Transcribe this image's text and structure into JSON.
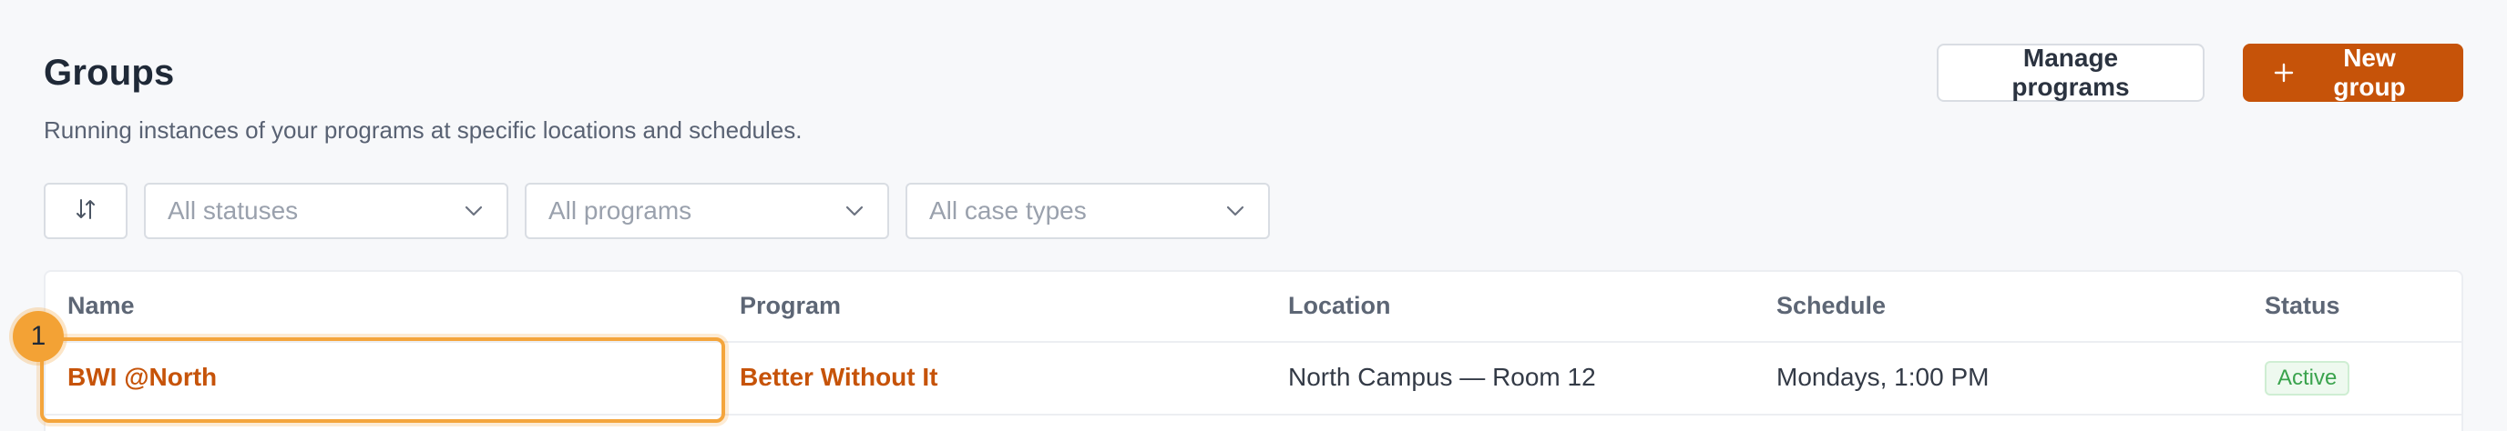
{
  "header": {
    "title": "Groups",
    "subtitle": "Running instances of your programs at specific locations and schedules.",
    "manage_label": "Manage programs",
    "new_label": "New group"
  },
  "filters": {
    "status": "All statuses",
    "program": "All programs",
    "case_type": "All case types"
  },
  "table": {
    "columns": [
      "Name",
      "Program",
      "Location",
      "Schedule",
      "Status"
    ],
    "rows": [
      {
        "name": "BWI @North",
        "program": "Better Without It",
        "location": "North Campus — Room 12",
        "schedule": "Mondays, 1:00 PM",
        "status": "Active"
      }
    ]
  },
  "annotation": {
    "marker": "1"
  },
  "colors": {
    "accent": "#c65309",
    "highlight": "#f4a53c",
    "status_active": "#3aa34d"
  },
  "icons": {
    "new_button": "plus-icon",
    "sort_button": "sort-arrows-icon",
    "select": "chevron-down-icon"
  }
}
